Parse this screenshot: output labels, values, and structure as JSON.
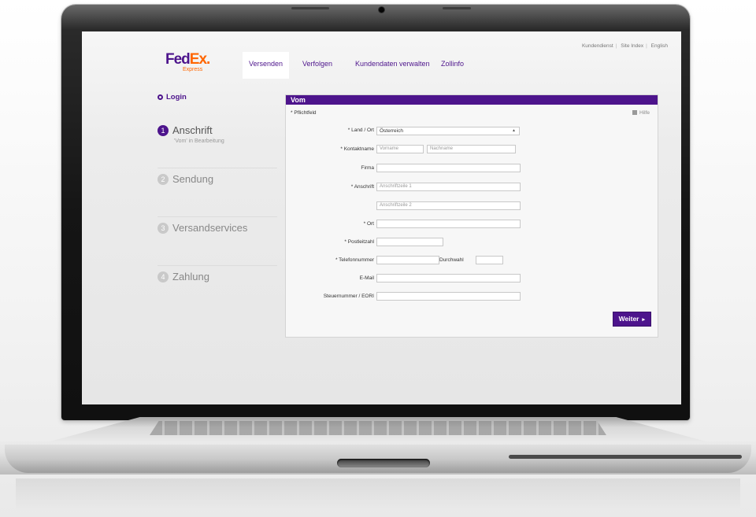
{
  "brand": {
    "logo_fed": "Fed",
    "logo_ex": "Ex",
    "logo_dot": ".",
    "logo_sub": "Express"
  },
  "nav": {
    "items": [
      "Versenden",
      "Verfolgen",
      "Kundendaten verwalten",
      "Zollinfo"
    ],
    "active": "Versenden"
  },
  "utility": {
    "links": [
      "Kundendienst",
      "Site Index",
      "English"
    ],
    "separator": "|"
  },
  "steps": {
    "login": "Login",
    "items": [
      {
        "num": "1",
        "label": "Anschrift",
        "sub": "'Vom' in Bearbeitung"
      },
      {
        "num": "2",
        "label": "Sendung"
      },
      {
        "num": "3",
        "label": "Versandservices"
      },
      {
        "num": "4",
        "label": "Zahlung"
      }
    ]
  },
  "form": {
    "title": "Vom",
    "required_note": "* Pflichtfeld",
    "help": "Hilfe",
    "country_label": "* Land / Ort",
    "country_value": "Österreich",
    "contact_label": "* Kontaktname",
    "contact_first_placeholder": "Vorname",
    "contact_last_placeholder": "Nachname",
    "company_label": "Firma",
    "address_label": "* Anschrift",
    "address1_placeholder": "Anschriftzeile 1",
    "address2_placeholder": "Anschriftzeile 2",
    "city_label": "* Ort",
    "postal_label": "* Postleitzahl",
    "phone_label": "* Telefonnummer",
    "ext_label": "Durchwahl",
    "email_label": "E-Mail",
    "tax_label": "Steuernummer / EORI",
    "submit_label": "Weiter",
    "submit_arrow": "▸"
  },
  "colors": {
    "fedex_purple": "#4d148c",
    "fedex_orange": "#ff6600"
  }
}
